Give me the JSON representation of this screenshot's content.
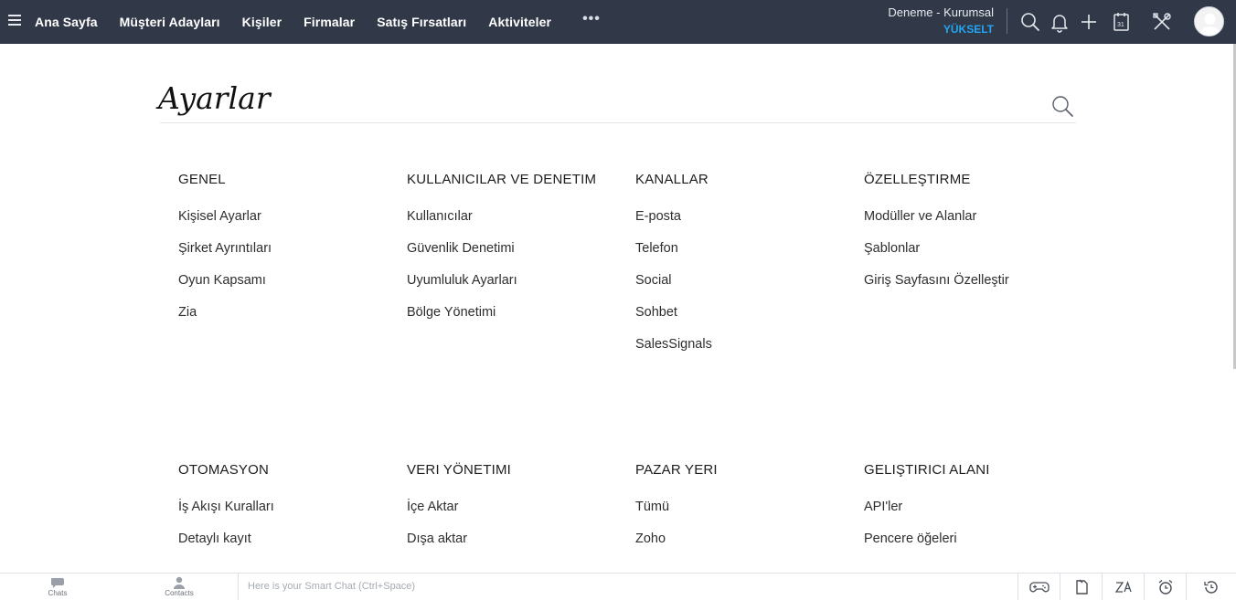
{
  "nav": {
    "items": [
      "Ana Sayfa",
      "Müşteri Adayları",
      "Kişiler",
      "Firmalar",
      "Satış Fırsatları",
      "Aktiviteler"
    ],
    "more": "•••"
  },
  "org": {
    "name": "Deneme - Kurumsal",
    "upgrade": "YÜKSELT"
  },
  "page": {
    "title": "Ayarlar"
  },
  "sections": [
    {
      "title": "GENEL",
      "links": [
        "Kişisel Ayarlar",
        "Şirket Ayrıntıları",
        "Oyun Kapsamı",
        "Zia"
      ]
    },
    {
      "title": "KULLANICILAR VE DENETIM",
      "links": [
        "Kullanıcılar",
        "Güvenlik Denetimi",
        "Uyumluluk Ayarları",
        "Bölge Yönetimi"
      ]
    },
    {
      "title": "KANALLAR",
      "links": [
        "E-posta",
        "Telefon",
        "Social",
        "Sohbet",
        "SalesSignals"
      ]
    },
    {
      "title": "ÖZELLEŞTIRME",
      "links": [
        "Modüller ve Alanlar",
        "Şablonlar",
        "Giriş Sayfasını Özelleştir"
      ]
    },
    {
      "title": "OTOMASYON",
      "links": [
        "İş Akışı Kuralları",
        "Detaylı kayıt"
      ]
    },
    {
      "title": "VERI YÖNETIMI",
      "links": [
        "İçe Aktar",
        "Dışa aktar"
      ]
    },
    {
      "title": "PAZAR YERI",
      "links": [
        "Tümü",
        "Zoho"
      ]
    },
    {
      "title": "GELIŞTIRICI ALANI",
      "links": [
        "API'ler",
        "Pencere öğeleri"
      ]
    }
  ],
  "bottom": {
    "chats": "Chats",
    "contacts": "Contacts",
    "smartchat_placeholder": "Here is your Smart Chat (Ctrl+Space)"
  },
  "colors": {
    "topbar": "#313949",
    "accent": "#22a6f2"
  }
}
